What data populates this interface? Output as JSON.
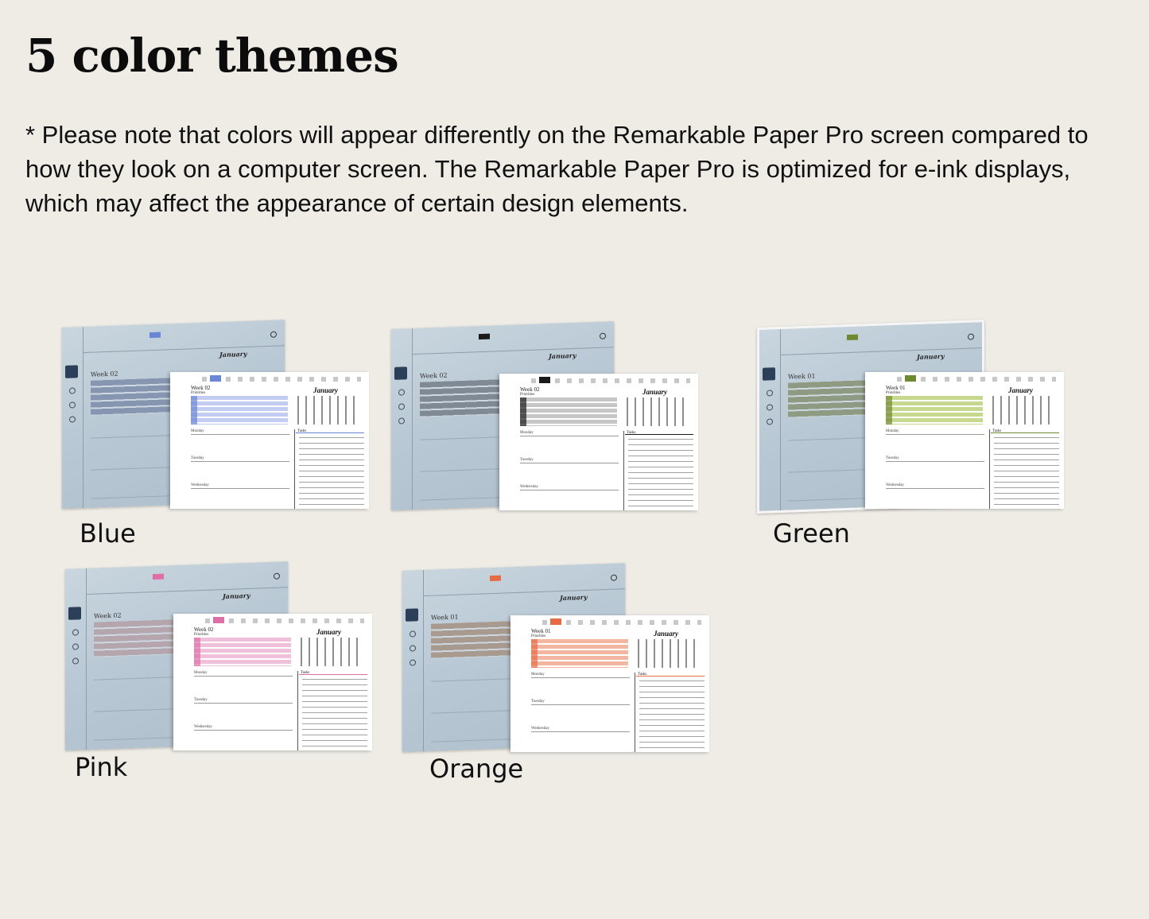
{
  "headline": "5 color themes",
  "note": "* Please note that colors will appear differently on the Remarkable Paper Pro screen compared to how they look on a computer screen. The Remarkable Paper Pro is optimized for e-ink displays, which may affect the appearance of certain design elements.",
  "themes": [
    {
      "label": "Blue",
      "accent": "#6a86d6",
      "front_bar": "#c3cdf2",
      "back_bar": "#8796b0",
      "week": "Week 02"
    },
    {
      "label": "",
      "accent": "#1a1a1a",
      "front_bar": "#c6c6c6",
      "back_bar": "#808a94",
      "week": "Week 02"
    },
    {
      "label": "Green",
      "accent": "#6f8a2e",
      "front_bar": "#c6d98e",
      "back_bar": "#8e9a82",
      "week": "Week 01"
    },
    {
      "label": "Pink",
      "accent": "#de6fa6",
      "front_bar": "#f0bfd9",
      "back_bar": "#b5a5ad",
      "week": "Week 02"
    },
    {
      "label": "Orange",
      "accent": "#e66c46",
      "front_bar": "#f3b6a0",
      "back_bar": "#a99a90",
      "week": "Week 01"
    }
  ],
  "mockup": {
    "calendar_title": "January",
    "priorities": "Priorities",
    "tasks": "Tasks",
    "days": [
      "Monday",
      "Tuesday",
      "Wednesday"
    ]
  }
}
